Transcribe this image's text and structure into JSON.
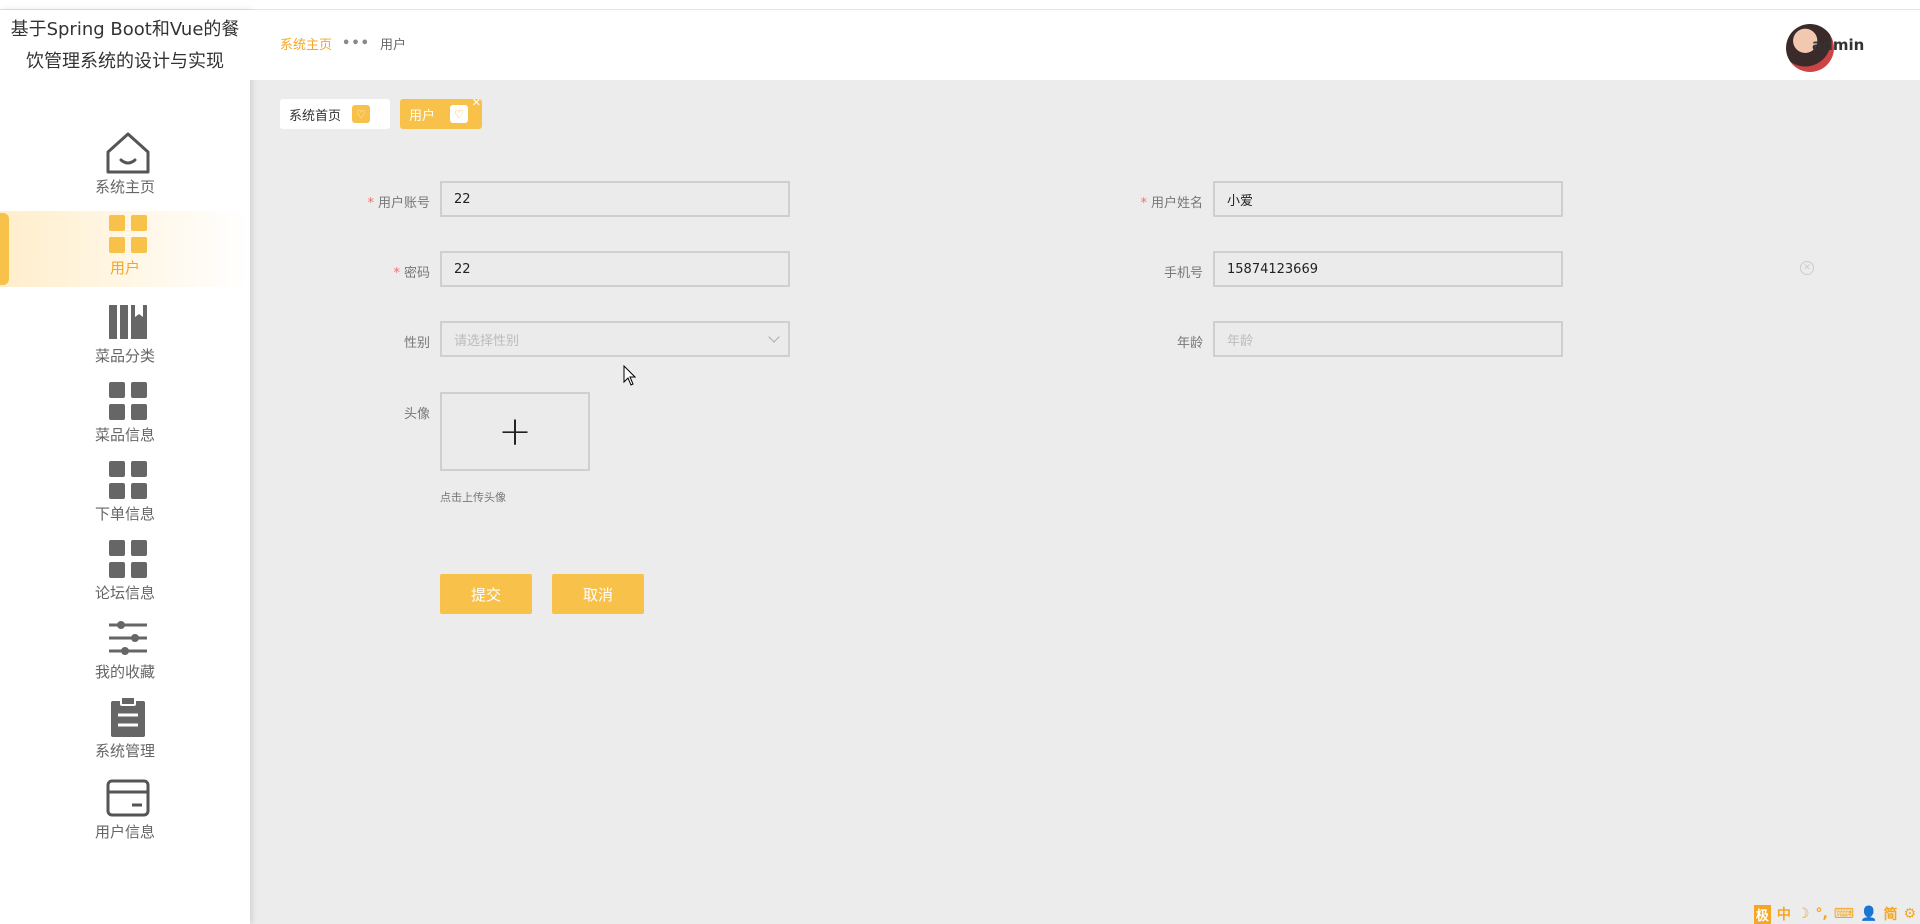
{
  "app": {
    "title": "基于Spring Boot和Vue的餐饮管理系统的设计与实现"
  },
  "sidebar": {
    "items": [
      {
        "label": "系统主页",
        "icon": "home-icon"
      },
      {
        "label": "用户",
        "icon": "grid-icon",
        "active": true
      },
      {
        "label": "菜品分类",
        "icon": "book-icon"
      },
      {
        "label": "菜品信息",
        "icon": "grid-icon"
      },
      {
        "label": "下单信息",
        "icon": "grid-icon"
      },
      {
        "label": "论坛信息",
        "icon": "grid-icon"
      },
      {
        "label": "我的收藏",
        "icon": "sliders-icon"
      },
      {
        "label": "系统管理",
        "icon": "clipboard-icon"
      },
      {
        "label": "用户信息",
        "icon": "card-icon"
      }
    ]
  },
  "header": {
    "breadcrumb": {
      "home": "系统主页",
      "separator": "•••",
      "current": "用户"
    },
    "username": "admin"
  },
  "tags": [
    {
      "label": "系统首页"
    },
    {
      "label": "用户",
      "active": true
    }
  ],
  "form": {
    "account": {
      "label": "用户账号",
      "value": "22",
      "required": true
    },
    "name": {
      "label": "用户姓名",
      "value": "小爱",
      "required": true
    },
    "password": {
      "label": "密码",
      "value": "22",
      "required": true
    },
    "phone": {
      "label": "手机号",
      "value": "15874123669"
    },
    "gender": {
      "label": "性别",
      "placeholder": "请选择性别"
    },
    "age": {
      "label": "年龄",
      "placeholder": "年龄"
    },
    "avatar": {
      "label": "头像",
      "upload_symbol": "+",
      "tip": "点击上传头像"
    },
    "submit_label": "提交",
    "cancel_label": "取消"
  },
  "ime": {
    "items": [
      "极",
      "中",
      "☽",
      "°,",
      "⌨",
      "👤",
      "简",
      "⚙"
    ]
  },
  "colors": {
    "accent": "#f8c14a",
    "accent_text": "#f5a623",
    "background": "#ececec"
  }
}
